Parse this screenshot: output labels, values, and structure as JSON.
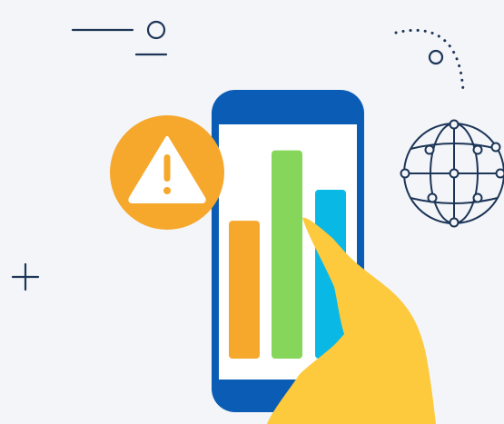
{
  "illustration": {
    "icons": [
      "line-circle-decoration-icon",
      "dotted-arc-decoration-icon",
      "plus-icon",
      "warning-icon",
      "globe-network-icon",
      "smartphone-icon",
      "hand-icon"
    ],
    "bars": [
      {
        "color": "#f6a82d",
        "level": 0.49
      },
      {
        "color": "#85d65a",
        "level": 0.74
      },
      {
        "color": "#0ab8e6",
        "level": 0.6
      }
    ],
    "colors": {
      "background": "#f3f5f9",
      "navy": "#1d3557",
      "phone_frame": "#0b5cb5",
      "warning": "#f6a82d",
      "hand": "#fdc93d"
    }
  }
}
